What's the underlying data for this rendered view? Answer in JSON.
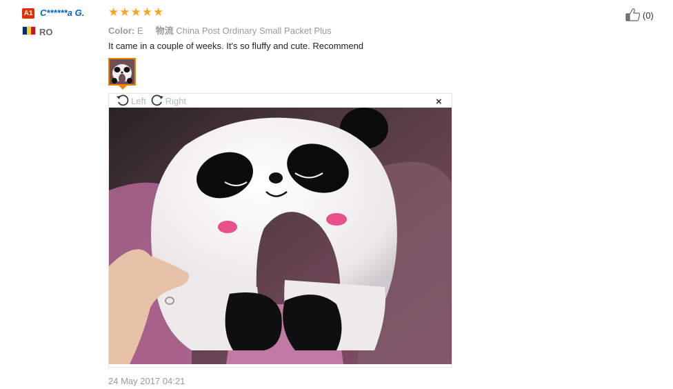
{
  "user": {
    "level_badge": "A1",
    "name": "C******a G.",
    "country_code": "RO",
    "flag_colors": [
      "#002b7f",
      "#fcd116",
      "#ce1126"
    ]
  },
  "review": {
    "rating": 5,
    "star_color": "#f5a623",
    "sku_color_label": "Color:",
    "sku_color_value": "E",
    "sku_shipping_label": "物流",
    "sku_shipping_value": "China Post Ordinary Small Packet Plus",
    "text": "It came in a couple of weeks. It's so fluffy and cute. Recommend",
    "date": "24 May 2017 04:21"
  },
  "helpful": {
    "count": "(0)"
  },
  "viewer": {
    "rotate_left": "Left",
    "rotate_right": "Right",
    "close": "×",
    "image_description": "panda travel pillow photo"
  },
  "colors": {
    "accent": "#f08200",
    "link": "#0066c0",
    "badge": "#e62e04"
  }
}
